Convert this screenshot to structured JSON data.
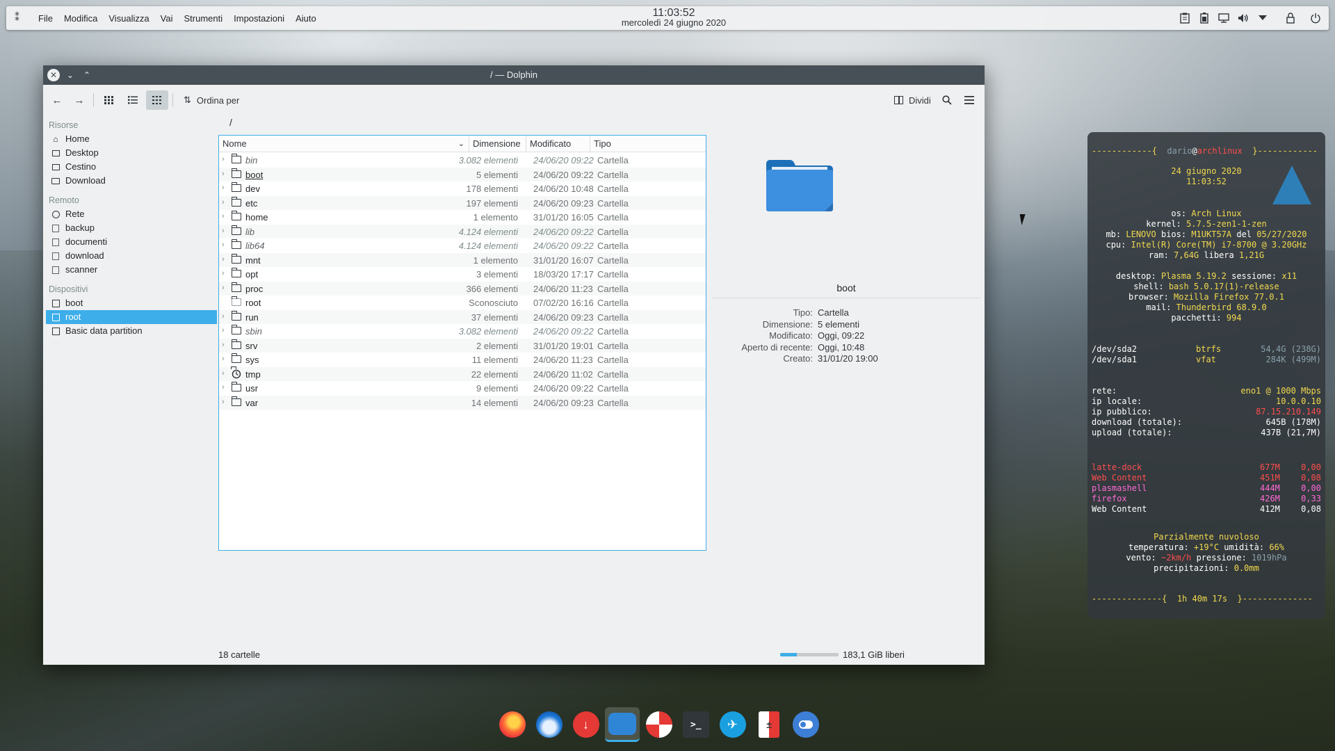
{
  "top_panel": {
    "menu": [
      "File",
      "Modifica",
      "Visualizza",
      "Vai",
      "Strumenti",
      "Impostazioni",
      "Aiuto"
    ],
    "clock_time": "11:03:52",
    "clock_date": "mercoledì 24 giugno 2020",
    "tray_icons": [
      "clipboard-icon",
      "battery-icon",
      "network-icon",
      "volume-icon",
      "expand-arrow-icon",
      "lock-icon",
      "power-icon"
    ]
  },
  "window": {
    "title": "/ — Dolphin",
    "toolbar": {
      "sort_label": "Ordina per",
      "split_label": "Dividi"
    },
    "places": {
      "sections": [
        {
          "title": "Risorse",
          "items": [
            {
              "label": "Home",
              "icon": "home-icon"
            },
            {
              "label": "Desktop",
              "icon": "desktop-icon"
            },
            {
              "label": "Cestino",
              "icon": "trash-icon"
            },
            {
              "label": "Download",
              "icon": "folder-icon"
            }
          ]
        },
        {
          "title": "Remoto",
          "items": [
            {
              "label": "Rete",
              "icon": "network-icon"
            },
            {
              "label": "backup",
              "icon": "bookmark-icon"
            },
            {
              "label": "documenti",
              "icon": "bookmark-icon"
            },
            {
              "label": "download",
              "icon": "bookmark-icon"
            },
            {
              "label": "scanner",
              "icon": "bookmark-icon"
            }
          ]
        },
        {
          "title": "Dispositivi",
          "items": [
            {
              "label": "boot",
              "icon": "drive-icon"
            },
            {
              "label": "root",
              "icon": "drive-icon",
              "selected": true
            },
            {
              "label": "Basic data partition",
              "icon": "drive-icon"
            }
          ]
        }
      ]
    },
    "breadcrumb": "/",
    "columns": [
      "Nome",
      "Dimensione",
      "Modificato",
      "Tipo"
    ],
    "files": [
      {
        "name": "bin",
        "size": "3.082 elementi",
        "modified": "24/06/20 09:22",
        "type": "Cartella",
        "italic": true
      },
      {
        "name": "boot",
        "size": "5 elementi",
        "modified": "24/06/20 09:22",
        "type": "Cartella",
        "underline": true
      },
      {
        "name": "dev",
        "size": "178 elementi",
        "modified": "24/06/20 10:48",
        "type": "Cartella"
      },
      {
        "name": "etc",
        "size": "197 elementi",
        "modified": "24/06/20 09:23",
        "type": "Cartella"
      },
      {
        "name": "home",
        "size": "1 elemento",
        "modified": "31/01/20 16:05",
        "type": "Cartella"
      },
      {
        "name": "lib",
        "size": "4.124 elementi",
        "modified": "24/06/20 09:22",
        "type": "Cartella",
        "italic": true
      },
      {
        "name": "lib64",
        "size": "4.124 elementi",
        "modified": "24/06/20 09:22",
        "type": "Cartella",
        "italic": true
      },
      {
        "name": "mnt",
        "size": "1 elemento",
        "modified": "31/01/20 16:07",
        "type": "Cartella"
      },
      {
        "name": "opt",
        "size": "3 elementi",
        "modified": "18/03/20 17:17",
        "type": "Cartella"
      },
      {
        "name": "proc",
        "size": "366 elementi",
        "modified": "24/06/20 11:23",
        "type": "Cartella"
      },
      {
        "name": "root",
        "size": "Sconosciuto",
        "modified": "07/02/20 16:16",
        "type": "Cartella",
        "locked": true
      },
      {
        "name": "run",
        "size": "37 elementi",
        "modified": "24/06/20 09:23",
        "type": "Cartella"
      },
      {
        "name": "sbin",
        "size": "3.082 elementi",
        "modified": "24/06/20 09:22",
        "type": "Cartella",
        "italic": true
      },
      {
        "name": "srv",
        "size": "2 elementi",
        "modified": "31/01/20 19:01",
        "type": "Cartella"
      },
      {
        "name": "sys",
        "size": "11 elementi",
        "modified": "24/06/20 11:23",
        "type": "Cartella"
      },
      {
        "name": "tmp",
        "size": "22 elementi",
        "modified": "24/06/20 11:02",
        "type": "Cartella",
        "clock_icon": true
      },
      {
        "name": "usr",
        "size": "9 elementi",
        "modified": "24/06/20 09:22",
        "type": "Cartella"
      },
      {
        "name": "var",
        "size": "14 elementi",
        "modified": "24/06/20 09:23",
        "type": "Cartella"
      }
    ],
    "info_panel": {
      "name": "boot",
      "rows": [
        {
          "k": "Tipo:",
          "v": "Cartella"
        },
        {
          "k": "Dimensione:",
          "v": "5 elementi"
        },
        {
          "k": "Modificato:",
          "v": "Oggi, 09:22"
        },
        {
          "k": "Aperto di recente:",
          "v": "Oggi, 10:48"
        },
        {
          "k": "Creato:",
          "v": "31/01/20 19:00"
        }
      ]
    },
    "status": {
      "count": "18 cartelle",
      "free": "183,1 GiB liberi",
      "usage_fraction": 0.28
    }
  },
  "conky": {
    "header_left": "------------{  ",
    "user": "dario",
    "at": "@",
    "host": "archlinux",
    "header_right": "  }------------",
    "date": "24 giugno 2020",
    "time": "11:03:52",
    "os_k": "os:",
    "os_v": "Arch Linux",
    "kernel_k": "kernel:",
    "kernel_v": "5.7.5-zen1-1-zen",
    "mb_k": "mb:",
    "mb_v": "LENOVO",
    "bios_k": "bios:",
    "bios_v": "M1UKT57A",
    "del_k": "del",
    "del_v": "05/27/2020",
    "cpu_k": "cpu:",
    "cpu_v": "Intel(R) Core(TM) i7-8700 @ 3.20GHz",
    "ram_k": "ram:",
    "ram_v": "7,64G",
    "libera_k": "libera",
    "libera_v": "1,21G",
    "desktop_k": "desktop:",
    "desktop_v": "Plasma 5.19.2",
    "sessione_k": "sessione:",
    "sessione_v": "x11",
    "shell_k": "shell:",
    "shell_v": "bash 5.0.17(1)-release",
    "browser_k": "browser:",
    "browser_v": "Mozilla Firefox 77.0.1",
    "mail_k": "mail:",
    "mail_v": "Thunderbird 68.9.0",
    "pacchetti_k": "pacchetti:",
    "pacchetti_v": "994",
    "disks": [
      {
        "dev": "/dev/sda2",
        "fs": "btrfs",
        "size": "54,4G (238G)"
      },
      {
        "dev": "/dev/sda1",
        "fs": "vfat",
        "size": "284K (499M)"
      }
    ],
    "rete_k": "rete:",
    "rete_v": "eno1 @ 1000 Mbps",
    "ip_locale_k": "ip locale:",
    "ip_locale_v": "10.0.0.10",
    "ip_pubblico_k": "ip pubblico:",
    "ip_pubblico_v": "87.15.210.149",
    "download_k": "download (totale):",
    "download_v": "645B (178M)",
    "upload_k": "upload (totale):",
    "upload_v": "437B (21,7M)",
    "procs": [
      {
        "name": "latte-dock",
        "mem": "677M",
        "cpu": "0,00",
        "hot": true
      },
      {
        "name": "Web Content",
        "mem": "451M",
        "cpu": "0,08",
        "hot": true
      },
      {
        "name": "plasmashell",
        "mem": "444M",
        "cpu": "0,00",
        "warm": true
      },
      {
        "name": "firefox",
        "mem": "426M",
        "cpu": "0,33",
        "warm": true
      },
      {
        "name": "Web Content",
        "mem": "412M",
        "cpu": "0,08"
      }
    ],
    "weather": "Parzialmente nuvoloso",
    "temperatura_k": "temperatura:",
    "temperatura_v": "+19°C",
    "umidita_k": "umidità:",
    "umidita_v": "66%",
    "vento_k": "vento:",
    "vento_v": "~2km/h",
    "pressione_k": "pressione:",
    "pressione_v": "1019hPa",
    "precip_k": "precipitazioni:",
    "precip_v": "0.0mm",
    "footer_left": "--------------{  ",
    "uptime": "1h 40m 17s",
    "footer_right": "  }--------------"
  },
  "dock": [
    "firefox-icon",
    "thunderbird-icon",
    "downloader-icon",
    "dolphin-icon",
    "help-icon",
    "terminal-icon",
    "discover-icon",
    "calculator-icon",
    "settings-toggle-icon"
  ]
}
